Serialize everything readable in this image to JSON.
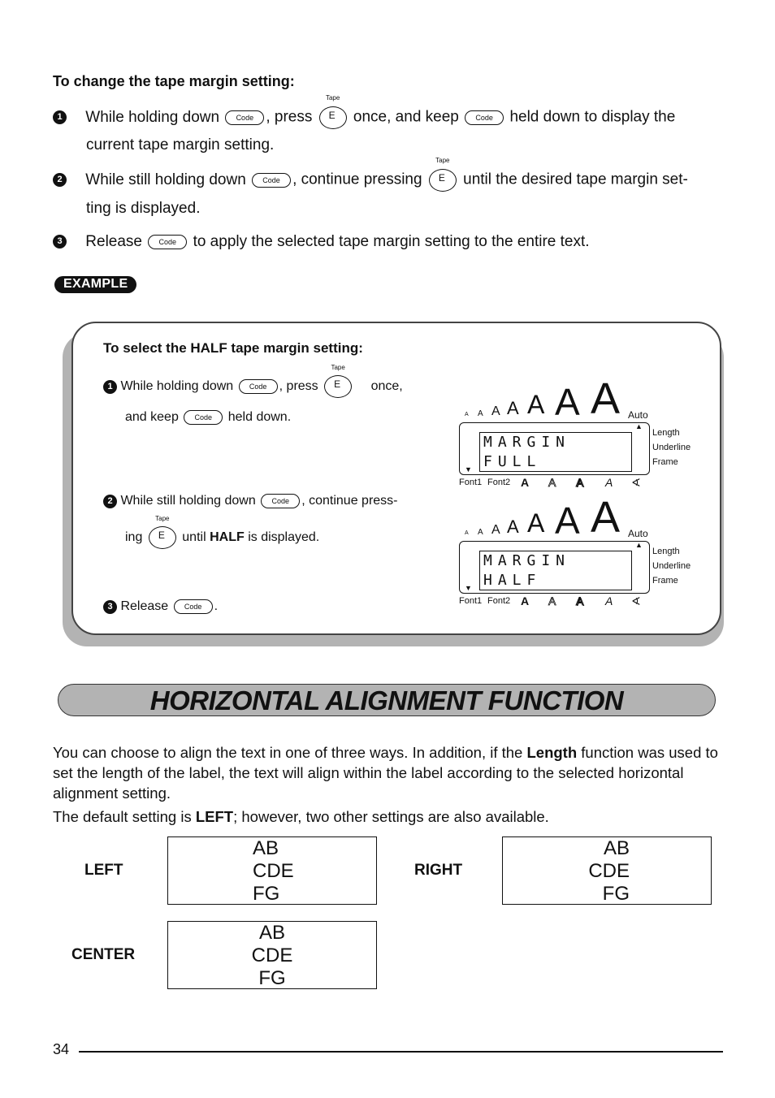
{
  "instructions": {
    "heading": "To change the tape margin setting:",
    "steps": [
      {
        "num": "1",
        "parts": [
          "While holding down",
          ", press",
          "once, and keep",
          "held down to display the"
        ],
        "continuation": "current tape margin setting."
      },
      {
        "num": "2",
        "parts": [
          "While still holding down",
          ", continue pressing",
          "until the desired tape margin set-"
        ],
        "continuation": "ting is displayed."
      },
      {
        "num": "3",
        "parts": [
          "Release",
          "to apply the selected tape margin setting to the entire text."
        ]
      }
    ]
  },
  "keys": {
    "code_label": "Code",
    "e_label": "E",
    "tape_label": "Tape"
  },
  "example": {
    "badge": "EXAMPLE",
    "heading": "To select the HALF tape margin setting:",
    "steps": [
      {
        "num": "1",
        "parts": [
          "While  holding  down",
          ",  press",
          "once,"
        ],
        "continuation": [
          "and keep",
          "held down."
        ]
      },
      {
        "num": "2",
        "parts": [
          "While still holding down",
          ", continue press-"
        ],
        "continuation": [
          "ing",
          "until",
          "HALF",
          "is displayed."
        ]
      },
      {
        "num": "3",
        "parts": [
          "Release",
          "."
        ]
      }
    ],
    "displays": [
      {
        "line1": "MARGIN",
        "line2": "FULL"
      },
      {
        "line1": "MARGIN",
        "line2": "HALF"
      }
    ],
    "lcd": {
      "size_glyph": "A",
      "auto_label": "Auto",
      "side_labels": [
        "Length",
        "Underline",
        "Frame"
      ],
      "bottom_labels": [
        "Font1",
        "Font2",
        "A",
        "A",
        "A",
        "A",
        "∢"
      ]
    }
  },
  "section": {
    "title": "HORIZONTAL ALIGNMENT FUNCTION",
    "paragraph1_parts": [
      "You can choose to align the text in one of three ways. In addition, if the",
      "Length",
      "function was used to set the length of the label, the text will align within the label according to the selected horizontal alignment setting."
    ],
    "paragraph2_parts": [
      "The default setting is",
      "LEFT",
      "; however, two other settings are also available."
    ]
  },
  "alignments": [
    {
      "label": "LEFT",
      "lines": [
        "AB",
        "CDE",
        "FG"
      ]
    },
    {
      "label": "RIGHT",
      "lines": [
        "AB",
        "CDE",
        "FG"
      ]
    },
    {
      "label": "CENTER",
      "lines": [
        "AB",
        "CDE",
        "FG"
      ]
    }
  ],
  "footer": {
    "page_number": "34"
  }
}
